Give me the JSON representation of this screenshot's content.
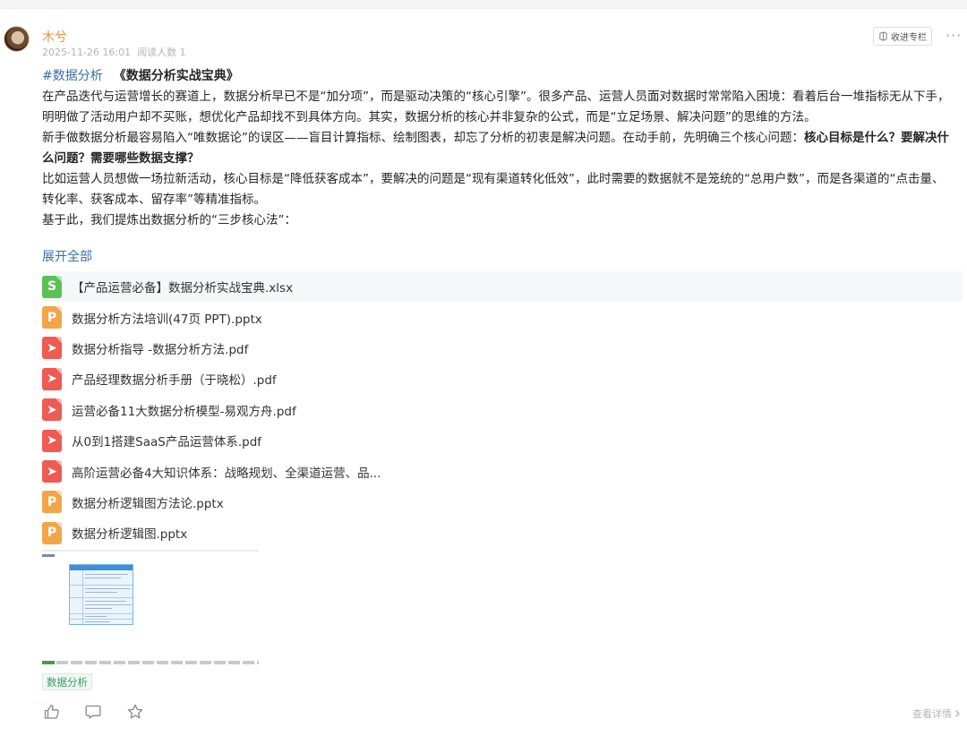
{
  "post": {
    "author": "木兮",
    "date": "2025-11-26 16:01",
    "views": "阅读人数 1",
    "collect_label": "收进专栏",
    "more_label": "···",
    "hashtag": "#数据分析",
    "book_title": "《数据分析实战宝典》",
    "paragraphs": [
      "在产品迭代与运营增长的赛道上，数据分析早已不是“加分项”，而是驱动决策的“核心引擎”。很多产品、运营人员面对数据时常常陷入困境：看着后台一堆指标无从下手，明明做了活动用户却不买账，想优化产品却找不到具体方向。其实，数据分析的核心并非复杂的公式，而是“立足场景、解决问题”的思维的方法。",
      "新手做数据分析最容易陷入“唯数据论”的误区——盲目计算指标、绘制图表，却忘了分析的初衷是解决问题。在动手前，先明确三个核心问题：",
      "核心目标是什么？要解决什么问题？需要哪些数据支撑？",
      "比如运营人员想做一场拉新活动，核心目标是“降低获客成本”，要解决的问题是“现有渠道转化低效”，此时需要的数据就不是笼统的“总用户数”，而是各渠道的“点击量、转化率、获客成本、留存率”等精准指标。",
      "基于此，我们提炼出数据分析的“三步核心法”："
    ],
    "expand_label": "展开全部",
    "tag": "数据分析",
    "details_label": "查看详情"
  },
  "files": [
    {
      "type": "xlsx",
      "glyph": "S",
      "name": "【产品运营必备】数据分析实战宝典.xlsx"
    },
    {
      "type": "pptx",
      "glyph": "P",
      "name": "数据分析方法培训(47页 PPT).pptx"
    },
    {
      "type": "pdf",
      "glyph": "➤",
      "name": "数据分析指导 -数据分析方法.pdf"
    },
    {
      "type": "pdf",
      "glyph": "➤",
      "name": "产品经理数据分析手册（于晓松）.pdf"
    },
    {
      "type": "pdf",
      "glyph": "➤",
      "name": "运营必备11大数据分析模型-易观方舟.pdf"
    },
    {
      "type": "pdf",
      "glyph": "➤",
      "name": "从0到1搭建SaaS产品运营体系.pdf"
    },
    {
      "type": "pdf",
      "glyph": "➤",
      "name": "高阶运营必备4大知识体系：战略规划、全渠道运营、品..."
    },
    {
      "type": "pptx",
      "glyph": "P",
      "name": "数据分析逻辑图方法论.pptx"
    },
    {
      "type": "pptx",
      "glyph": "P",
      "name": "数据分析逻辑图.pptx"
    }
  ],
  "colors": {
    "author": "#e8923a",
    "link": "#3a6ea8",
    "xlsx_icon": "#5cc154",
    "pptx_icon": "#f3a449",
    "pdf_icon": "#ee5b52",
    "tag_text": "#3e9a64"
  },
  "icons": {
    "like": "thumbs-up-icon",
    "comment": "comment-bubble-icon",
    "favorite": "star-icon",
    "collect": "column-collect-icon",
    "details": "chevron-right-icon"
  }
}
